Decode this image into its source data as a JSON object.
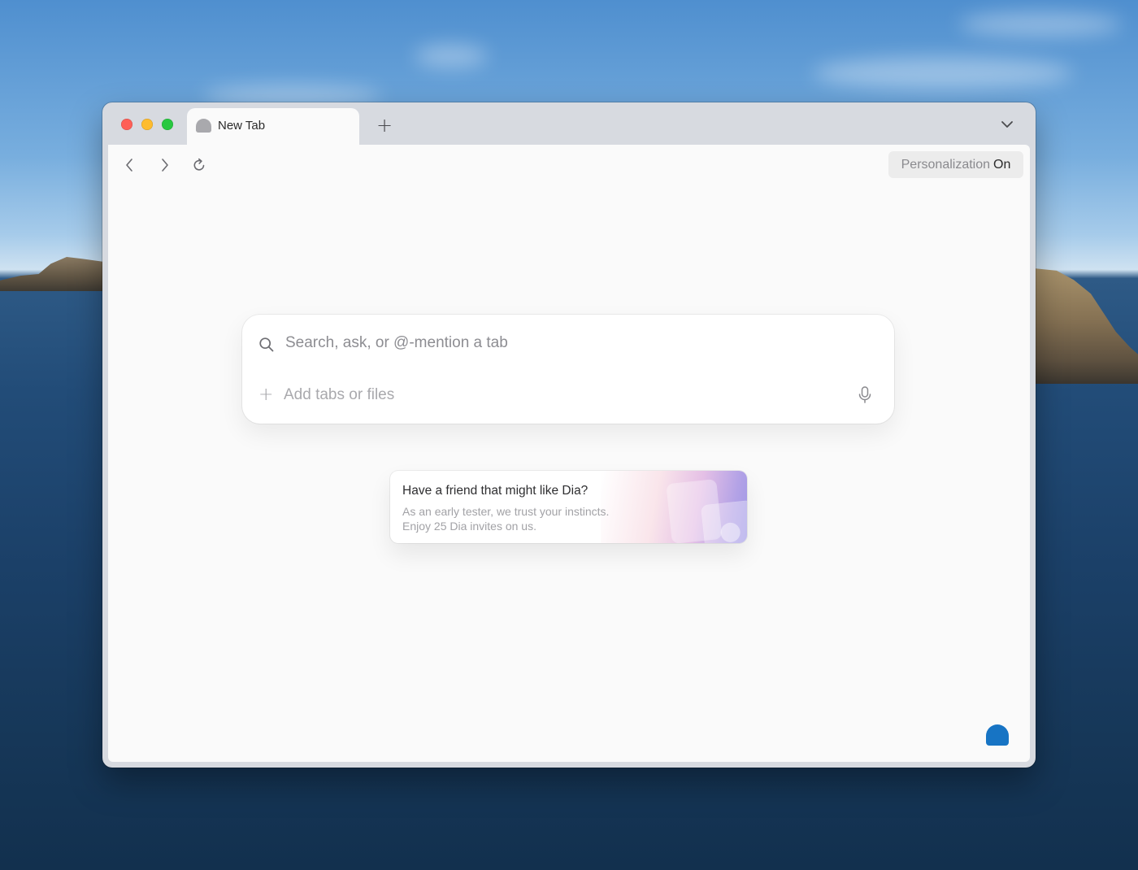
{
  "colors": {
    "accent": "#1774c4",
    "close": "#fe5f57",
    "minimize": "#febc2e",
    "zoom": "#28c840"
  },
  "window": {
    "traffic_lights": [
      "close",
      "minimize",
      "zoom"
    ]
  },
  "tab": {
    "title": "New Tab",
    "icon": "dia-logo-icon"
  },
  "tabbar": {
    "new_tab_icon": "+",
    "menu_icon": "chevron-down-icon"
  },
  "toolbar": {
    "back_icon": "chevron-left-icon",
    "forward_icon": "chevron-right-icon",
    "reload_icon": "reload-icon",
    "personalization_label": "Personalization",
    "personalization_state": "On"
  },
  "search": {
    "placeholder": "Search, ask, or @-mention a tab",
    "add_label": "Add tabs or files",
    "add_icon": "+",
    "mic_icon": "microphone-icon"
  },
  "invite": {
    "title": "Have a friend that might like Dia?",
    "line1": "As an early tester, we trust your instincts.",
    "line2": "Enjoy 25 Dia invites on us."
  },
  "assistant": {
    "icon": "dia-assistant-icon"
  }
}
